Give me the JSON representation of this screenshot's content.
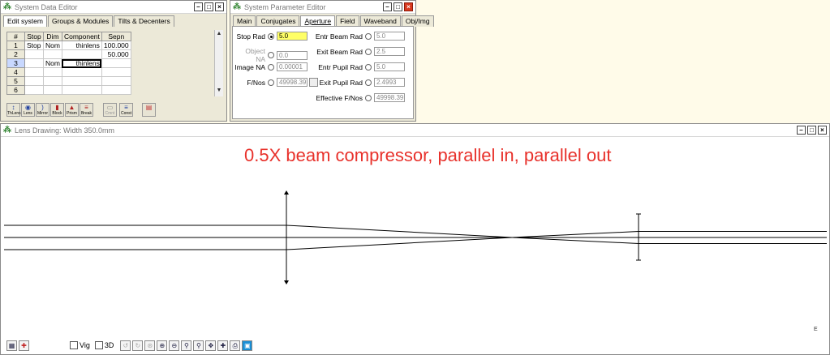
{
  "system_data_editor": {
    "title": "System Data Editor",
    "tabs": [
      "Edit system",
      "Groups & Modules",
      "Tilts & Decenters"
    ],
    "columns": [
      "#",
      "Stop",
      "Dim",
      "Component",
      "Sepn"
    ],
    "rows": [
      {
        "num": "1",
        "stop": "Stop",
        "dim": "Nom",
        "component": "thinlens",
        "sepn": "100.000"
      },
      {
        "num": "2",
        "stop": "",
        "dim": "",
        "component": "",
        "sepn": "50.000"
      },
      {
        "num": "3",
        "stop": "",
        "dim": "Nom",
        "component": "thinlens",
        "sepn": ""
      },
      {
        "num": "4",
        "stop": "",
        "dim": "",
        "component": "",
        "sepn": ""
      },
      {
        "num": "5",
        "stop": "",
        "dim": "",
        "component": "",
        "sepn": ""
      },
      {
        "num": "6",
        "stop": "",
        "dim": "",
        "component": "",
        "sepn": ""
      }
    ],
    "toolbar": [
      "ThLens",
      "Lens",
      "Mirror",
      "Block",
      "Prism",
      "Break",
      "Cmnt",
      "Const"
    ]
  },
  "system_parameter_editor": {
    "title": "System Parameter Editor",
    "tabs": [
      "Main",
      "Conjugates",
      "Aperture",
      "Field",
      "Waveband",
      "Obj/Img"
    ],
    "left": [
      {
        "label": "Stop Rad",
        "value": "5.0"
      },
      {
        "label": "Object NA",
        "value": "0.0"
      },
      {
        "label": "Image NA",
        "value": "0.00001"
      },
      {
        "label": "F/Nos",
        "value": "49998.39"
      }
    ],
    "right": [
      {
        "label": "Entr Beam Rad",
        "value": "5.0"
      },
      {
        "label": "Exit Beam Rad",
        "value": "2.5"
      },
      {
        "label": "Entr Pupil Rad",
        "value": "5.0"
      },
      {
        "label": "Exit Pupil Rad",
        "value": "2.4993"
      },
      {
        "label": "Effective F/Nos",
        "value": "49998.39"
      }
    ]
  },
  "lens_drawing": {
    "title": "Lens Drawing: Width  350.0mm",
    "annotation": "0.5X beam compressor, parallel in, parallel out",
    "vig_label": "Vig",
    "threed_label": "3D",
    "e_mark": "E",
    "accent": "#e8312b"
  }
}
